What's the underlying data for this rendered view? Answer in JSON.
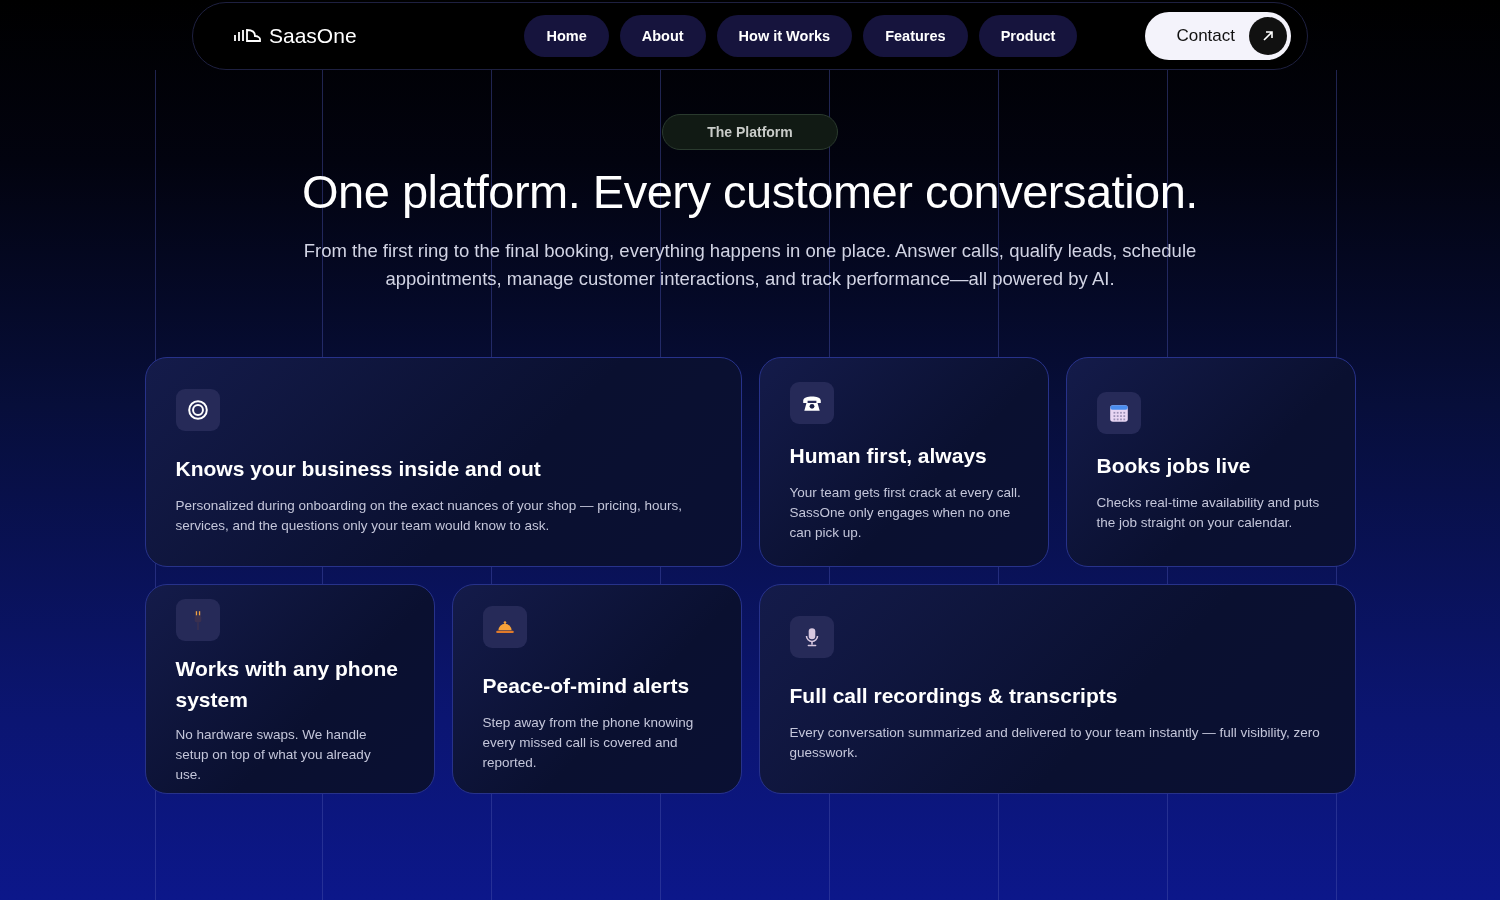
{
  "nav": {
    "logo": "SaasOne",
    "links": [
      {
        "label": "Home"
      },
      {
        "label": "About"
      },
      {
        "label": "How it Works"
      },
      {
        "label": "Features"
      },
      {
        "label": "Product"
      }
    ],
    "cta": "Contact"
  },
  "hero": {
    "badge": "The Platform",
    "title": "One platform. Every customer conversation.",
    "subtitle": "From the first ring to the final booking, everything happens in one place. Answer calls, qualify leads, schedule appointments, manage customer interactions, and track performance—all powered by AI."
  },
  "features": [
    {
      "title": "Knows your business inside and out",
      "text": "Personalized during onboarding on the exact nuances of your shop — pricing,  hours, services, and the questions only your team would know to ask."
    },
    {
      "title": "Human first, always",
      "text": "Your team gets first crack at every call. SassOne only engages when  no one can pick up."
    },
    {
      "title": "Books jobs live",
      "text": "Checks real-time availability and puts the job straight on your calendar."
    },
    {
      "title": "Works with any phone system",
      "text": "No hardware swaps. We handle setup on top of what you already use."
    },
    {
      "title": "Peace-of-mind alerts",
      "text": "Step away from the phone  knowing every missed call is  covered and reported."
    },
    {
      "title": "Full call recordings & transcripts",
      "text": "Every conversation summarized and delivered to your team instantly — full  visibility, zero guesswork."
    }
  ]
}
